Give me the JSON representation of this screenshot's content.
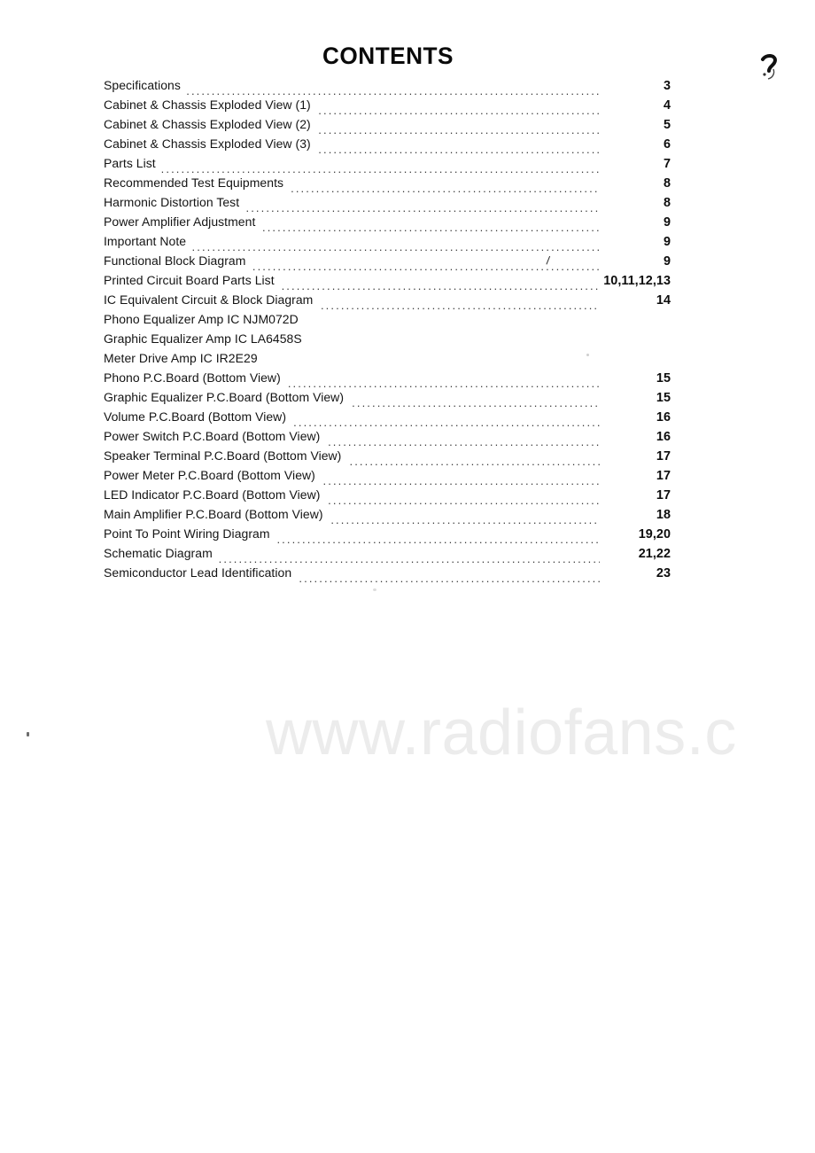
{
  "document": {
    "heading": "CONTENTS",
    "watermark": "www.radiofans.c"
  },
  "toc": {
    "entries": [
      {
        "label": "Specifications",
        "page": "3",
        "leader": true
      },
      {
        "label": "Cabinet & Chassis Exploded View (1)",
        "page": "4",
        "leader": true
      },
      {
        "label": "Cabinet & Chassis Exploded View (2)",
        "page": "5",
        "leader": true
      },
      {
        "label": "Cabinet & Chassis Exploded View (3)",
        "page": "6",
        "leader": true
      },
      {
        "label": "Parts List",
        "page": "7",
        "leader": true
      },
      {
        "label": "Recommended Test Equipments",
        "page": "8",
        "leader": true
      },
      {
        "label": "Harmonic Distortion Test",
        "page": "8",
        "leader": true
      },
      {
        "label": "Power Amplifier Adjustment",
        "page": "9",
        "leader": true
      },
      {
        "label": "Important Note",
        "page": "9",
        "leader": true
      },
      {
        "label": "Functional Block Diagram",
        "page": "9",
        "leader": true
      },
      {
        "label": "Printed Circuit Board Parts List",
        "page": "10,11,12,13",
        "leader": true
      },
      {
        "label": "IC Equivalent Circuit & Block Diagram",
        "page": "14",
        "leader": true
      },
      {
        "label": "Phono Equalizer Amp IC NJM072D",
        "page": "",
        "leader": false
      },
      {
        "label": "Graphic Equalizer Amp IC LA6458S",
        "page": "",
        "leader": false
      },
      {
        "label": "Meter Drive Amp IC IR2E29",
        "page": "",
        "leader": false
      },
      {
        "label": "Phono P.C.Board (Bottom View)",
        "page": "15",
        "leader": true
      },
      {
        "label": "Graphic Equalizer P.C.Board (Bottom View)",
        "page": "15",
        "leader": true
      },
      {
        "label": "Volume P.C.Board (Bottom View)",
        "page": "16",
        "leader": true
      },
      {
        "label": "Power Switch P.C.Board (Bottom View)",
        "page": "16",
        "leader": true
      },
      {
        "label": "Speaker Terminal P.C.Board (Bottom View)",
        "page": "17",
        "leader": true
      },
      {
        "label": "Power Meter P.C.Board (Bottom View)",
        "page": "17",
        "leader": true
      },
      {
        "label": "LED Indicator P.C.Board (Bottom View)",
        "page": "17",
        "leader": true
      },
      {
        "label": "Main Amplifier P.C.Board (Bottom View)",
        "page": "18",
        "leader": true
      },
      {
        "label": "Point To Point Wiring Diagram",
        "page": "19,20",
        "leader": true
      },
      {
        "label": "Schematic Diagram",
        "page": "21,22",
        "leader": true
      },
      {
        "label": "Semiconductor Lead Identification",
        "page": "23",
        "leader": true
      }
    ]
  }
}
